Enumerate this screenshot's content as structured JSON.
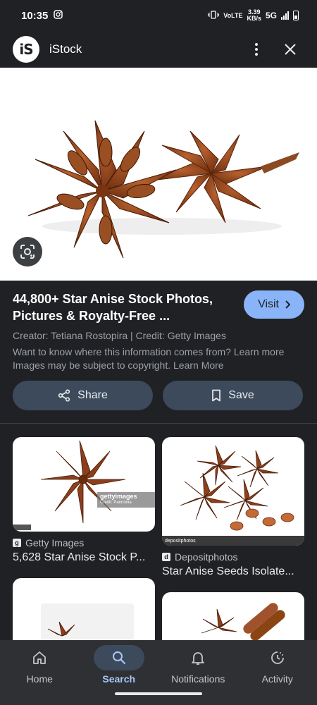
{
  "status_bar": {
    "time": "10:35",
    "network_top": "VoLTE",
    "speed": "3.39",
    "speed_unit": "KB/s",
    "network": "5G"
  },
  "header": {
    "logo_text": "iS",
    "title": "iStock"
  },
  "result": {
    "title": "44,800+ Star Anise Stock Photos, Pictures & Royalty-Free ...",
    "visit_label": "Visit",
    "creator": "Creator: Tetiana Rostopira | Credit: Getty Images",
    "info_note": "Want to know where this information comes from? Learn more",
    "copyright_note": "Images may be subject to copyright. Learn More"
  },
  "actions": {
    "share_label": "Share",
    "save_label": "Save"
  },
  "related": [
    {
      "source": "Getty Images",
      "source_icon": "g",
      "caption": "5,628 Star Anise Stock P...",
      "watermark": "gettyimages",
      "watermark_sub": "Credit: Pannonia"
    },
    {
      "source": "Depositphotos",
      "source_icon": "d",
      "caption": "Star Anise Seeds Isolate...",
      "watermark": "depositphotos"
    }
  ],
  "nav": {
    "items": [
      {
        "label": "Home",
        "icon": "home-icon"
      },
      {
        "label": "Search",
        "icon": "search-icon"
      },
      {
        "label": "Notifications",
        "icon": "bell-icon"
      },
      {
        "label": "Activity",
        "icon": "activity-icon"
      }
    ],
    "active": "Search"
  },
  "colors": {
    "background": "#202124",
    "accent": "#8ab4f8",
    "button_bg": "#3c4a5c",
    "anise": "#8b3f1a"
  }
}
